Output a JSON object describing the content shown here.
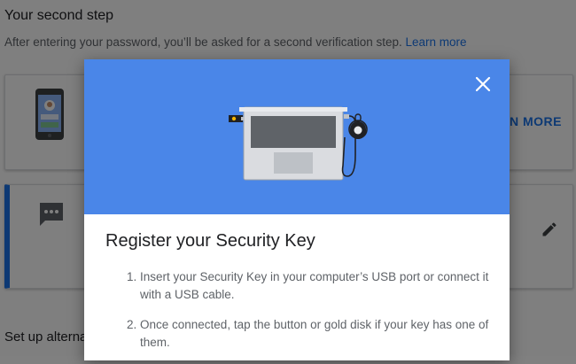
{
  "background": {
    "title": "Your second step",
    "subtitle": "After entering your password, you’ll be asked for a second verification step.",
    "learn_more_link": "Learn more",
    "card1_link": "LEARN MORE",
    "bottom_text": "Set up alternative second step"
  },
  "dialog": {
    "title": "Register your Security Key",
    "steps": [
      {
        "num": "1.",
        "text": "Insert your Security Key in your computer’s USB port or connect it with a USB cable."
      },
      {
        "num": "2.",
        "text": "Once connected, tap the button or gold disk if your key has one of them."
      }
    ],
    "close_icon": "close-icon"
  },
  "colors": {
    "accent": "#1a73e8",
    "hero": "#4a86e8",
    "key_gold": "#f4b400"
  }
}
